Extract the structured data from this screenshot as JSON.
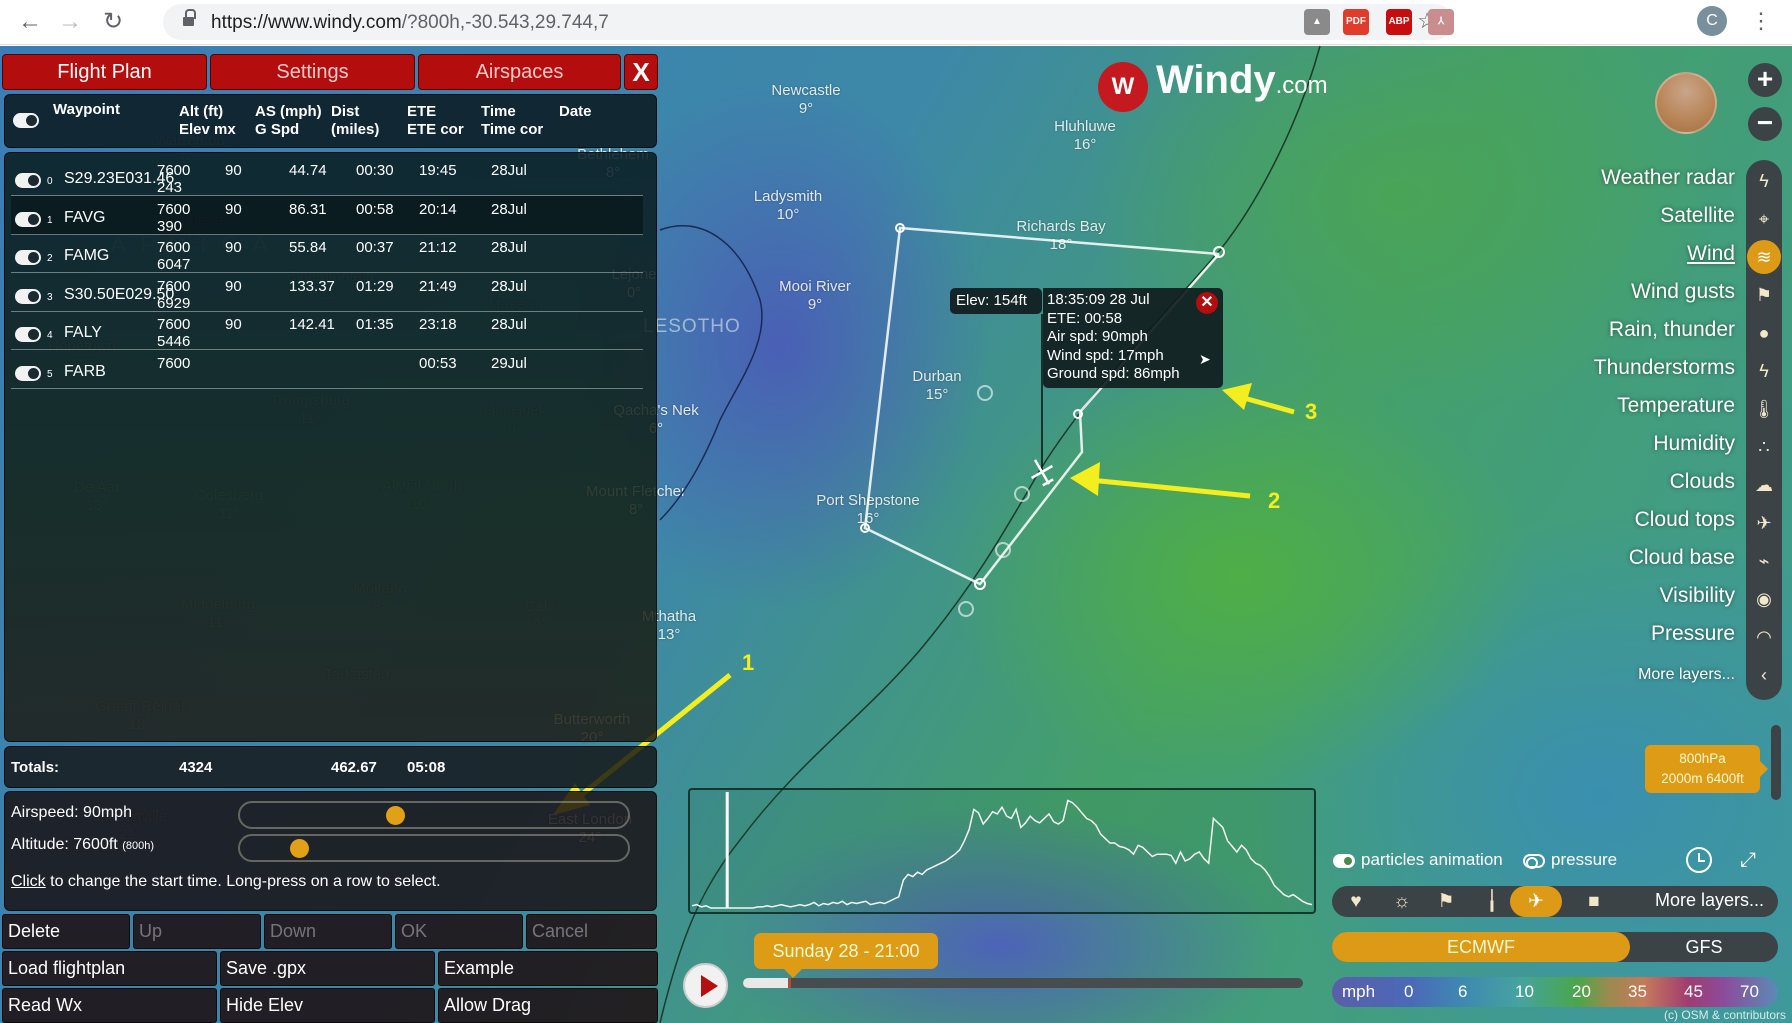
{
  "browser": {
    "url_prefix": "https://www.windy.com",
    "url_suffix": "/?800h,-30.543,29.744,7",
    "back_icon": "←",
    "forward_icon": "→",
    "reload_icon": "↻",
    "star_icon": "☆",
    "extensions": [
      {
        "name": "google-drive",
        "label": "▲",
        "color": "#8a8a8a"
      },
      {
        "name": "pdf-js",
        "label": "PDF",
        "color": "#e03c2c"
      },
      {
        "name": "adblock-plus",
        "label": "ABP",
        "color": "#c70d0d"
      },
      {
        "name": "acrobat",
        "label": "⅄",
        "color": "#c98d8d"
      }
    ],
    "profile_initial": "C",
    "menu_icon": "⋮"
  },
  "panel": {
    "tabs": [
      "Flight Plan",
      "Settings",
      "Airspaces"
    ],
    "active_tab": "Flight Plan",
    "close_label": "X",
    "headers": {
      "waypoint": "Waypoint",
      "alt": "Alt (ft)",
      "elev": "Elev mx",
      "as": "AS (mph)",
      "gspd": "G Spd",
      "dist": "Dist",
      "dist_unit": "(miles)",
      "ete": "ETE",
      "ete_cor": "ETE cor",
      "time": "Time",
      "time_cor": "Time cor",
      "date": "Date"
    },
    "rows": [
      {
        "idx": "0",
        "waypoint": "S29.23E031.46",
        "alt": "7600",
        "elev": "243",
        "as": "90",
        "dist": "44.74",
        "ete": "00:30",
        "time": "19:45",
        "date": "28Jul"
      },
      {
        "idx": "1",
        "waypoint": "FAVG",
        "alt": "7600",
        "elev": "390",
        "as": "90",
        "dist": "86.31",
        "ete": "00:58",
        "time": "20:14",
        "date": "28Jul"
      },
      {
        "idx": "2",
        "waypoint": "FAMG",
        "alt": "7600",
        "elev": "6047",
        "as": "90",
        "dist": "55.84",
        "ete": "00:37",
        "time": "21:12",
        "date": "28Jul"
      },
      {
        "idx": "3",
        "waypoint": "S30.50E029.50",
        "alt": "7600",
        "elev": "6929",
        "as": "90",
        "dist": "133.37",
        "ete": "01:29",
        "time": "21:49",
        "date": "28Jul"
      },
      {
        "idx": "4",
        "waypoint": "FALY",
        "alt": "7600",
        "elev": "5446",
        "as": "90",
        "dist": "142.41",
        "ete": "01:35",
        "time": "23:18",
        "date": "28Jul"
      },
      {
        "idx": "5",
        "waypoint": "FARB",
        "alt": "7600",
        "elev": "",
        "as": "",
        "dist": "",
        "ete": "",
        "time": "00:53",
        "date": "29Jul"
      }
    ],
    "totals": {
      "label": "Totals:",
      "elev": "4324",
      "dist": "462.67",
      "ete": "05:08"
    },
    "airspeed_label": "Airspeed: 90mph",
    "airspeed_fraction": 0.39,
    "altitude_label": "Altitude: 7600ft",
    "altitude_level": "(800h)",
    "altitude_fraction": 0.13,
    "hint_link": "Click",
    "hint_text": " to change the start time. Long-press on a row to select.",
    "buttons_row1": [
      {
        "label": "Delete",
        "enabled": true
      },
      {
        "label": "Up",
        "enabled": false
      },
      {
        "label": "Down",
        "enabled": false
      },
      {
        "label": "OK",
        "enabled": false
      },
      {
        "label": "Cancel",
        "enabled": false
      }
    ],
    "buttons_row2": [
      "Load flightplan",
      "Save .gpx",
      "Example"
    ],
    "buttons_row3": [
      "Read Wx",
      "Hide Elev",
      "Allow Drag"
    ]
  },
  "map": {
    "logo_text": "Windy",
    "logo_suffix": ".com",
    "country_labels": [
      "LESOTHO",
      "AFRICA"
    ],
    "places": [
      {
        "name": "Newcastle",
        "temp": "9°",
        "faded": false
      },
      {
        "name": "Bethlehem",
        "temp": "8°",
        "faded": false
      },
      {
        "name": "Hluhluwe",
        "temp": "16°",
        "faded": false
      },
      {
        "name": "Ladysmith",
        "temp": "10°",
        "faded": false
      },
      {
        "name": "Richards Bay",
        "temp": "18°",
        "faded": false
      },
      {
        "name": "Lejone",
        "temp": "0°",
        "faded": false
      },
      {
        "name": "Mooi River",
        "temp": "9°",
        "faded": false
      },
      {
        "name": "Durban",
        "temp": "15°",
        "faded": false
      },
      {
        "name": "Qacha's Nek",
        "temp": "6°",
        "faded": false
      },
      {
        "name": "Mount Fletcher",
        "temp": "8°",
        "faded": false
      },
      {
        "name": "Port Shepstone",
        "temp": "16°",
        "faded": false
      },
      {
        "name": "Mthatha",
        "temp": "13°",
        "faded": false
      },
      {
        "name": "Butterworth",
        "temp": "20°",
        "faded": false
      },
      {
        "name": "East London",
        "temp": "24°",
        "faded": false
      },
      {
        "name": "Warrenton",
        "temp": "10°",
        "faded": true
      },
      {
        "name": "Kimberley",
        "temp": "12°",
        "faded": true
      },
      {
        "name": "Bloemfontein",
        "temp": "13°",
        "faded": true
      },
      {
        "name": "Maseru",
        "temp": "",
        "faded": true
      },
      {
        "name": "Hopetown",
        "temp": "12°",
        "faded": true
      },
      {
        "name": "Trompsburg",
        "temp": "11°",
        "faded": true
      },
      {
        "name": "Old Hoek",
        "temp": "9°",
        "faded": true
      },
      {
        "name": "De Aar",
        "temp": "13°",
        "faded": true
      },
      {
        "name": "Colesberg",
        "temp": "11°",
        "faded": true
      },
      {
        "name": "Aliwal North",
        "temp": "10°",
        "faded": true
      },
      {
        "name": "Molteno",
        "temp": "8°",
        "faded": true
      },
      {
        "name": "Middelburg",
        "temp": "11°",
        "faded": true
      },
      {
        "name": "Cala",
        "temp": "9°",
        "faded": true
      },
      {
        "name": "Graaff-Reinet",
        "temp": "18°",
        "faded": true
      },
      {
        "name": "Tarkastad",
        "temp": "",
        "faded": true
      },
      {
        "name": "Jansenville",
        "temp": "21°",
        "faded": true
      },
      {
        "name": "Willowmore",
        "temp": "",
        "faded": true
      }
    ],
    "popup": {
      "elev": "Elev: 154ft",
      "lines": [
        "18:35:09   28 Jul",
        "ETE: 00:58",
        "Air spd: 90mph",
        "Wind spd: 17mph",
        "Ground spd: 86mph"
      ],
      "close_label": "✕"
    },
    "annotations": [
      "1",
      "2",
      "3"
    ]
  },
  "layers": {
    "zoom_in": "+",
    "zoom_out": "−",
    "items": [
      {
        "label": "Weather radar",
        "icon": "weather-radar-icon",
        "glyph": "ϟ"
      },
      {
        "label": "Satellite",
        "icon": "satellite-icon",
        "glyph": "⌖"
      },
      {
        "label": "Wind",
        "icon": "wind-icon",
        "glyph": "≋",
        "active": true
      },
      {
        "label": "Wind gusts",
        "icon": "windsock-icon",
        "glyph": "⚑"
      },
      {
        "label": "Rain, thunder",
        "icon": "raindrop-icon",
        "glyph": "●"
      },
      {
        "label": "Thunderstorms",
        "icon": "thunderstorm-icon",
        "glyph": "ϟ"
      },
      {
        "label": "Temperature",
        "icon": "thermometer-icon",
        "glyph": "🌡"
      },
      {
        "label": "Humidity",
        "icon": "humidity-icon",
        "glyph": "∴"
      },
      {
        "label": "Clouds",
        "icon": "clouds-icon",
        "glyph": "☁"
      },
      {
        "label": "Cloud tops",
        "icon": "airplane-icon",
        "glyph": "✈"
      },
      {
        "label": "Cloud base",
        "icon": "helicopter-icon",
        "glyph": "⌁"
      },
      {
        "label": "Visibility",
        "icon": "eye-icon",
        "glyph": "◉"
      },
      {
        "label": "Pressure",
        "icon": "gauge-icon",
        "glyph": "◠"
      },
      {
        "label": "More layers...",
        "icon": "chevron-left-icon",
        "glyph": "‹"
      }
    ],
    "level_line1": "800hPa",
    "level_line2": "2000m 6400ft"
  },
  "bottom": {
    "particles_label": "particles animation",
    "pressure_label": "pressure",
    "quickbar_icons": [
      {
        "name": "heart-icon",
        "glyph": "♥"
      },
      {
        "name": "sun-cloud-icon",
        "glyph": "☼"
      },
      {
        "name": "windsock-icon",
        "glyph": "⚑"
      },
      {
        "name": "thermometer-icon",
        "glyph": "╽"
      },
      {
        "name": "airplane-icon",
        "glyph": "✈",
        "active": true
      },
      {
        "name": "video-camera-icon",
        "glyph": "■"
      }
    ],
    "quickbar_more": "More layers...",
    "models": [
      "ECMWF",
      "GFS"
    ],
    "active_model": "ECMWF",
    "legend_unit": "mph",
    "legend_values": [
      "0",
      "6",
      "10",
      "20",
      "35",
      "45",
      "70"
    ],
    "time_label": "Sunday 28 - 21:00",
    "timeline_progress": 0.085,
    "attribution": "(c) OSM & contributors"
  },
  "elevation_profile": {
    "current_position_fraction": 0.06,
    "values": [
      2,
      3,
      1,
      2,
      0,
      0,
      0,
      0,
      0,
      0,
      0,
      0,
      0,
      0,
      1,
      1,
      2,
      1,
      2,
      3,
      2,
      1,
      2,
      3,
      2,
      3,
      5,
      2,
      4,
      3,
      5,
      4,
      6,
      3,
      5,
      4,
      5,
      6,
      3,
      4,
      5,
      4,
      6,
      8,
      10,
      25,
      30,
      28,
      32,
      30,
      34,
      36,
      38,
      40,
      42,
      45,
      48,
      52,
      60,
      70,
      88,
      85,
      75,
      80,
      86,
      84,
      90,
      82,
      80,
      88,
      72,
      76,
      82,
      78,
      76,
      80,
      84,
      77,
      75,
      78,
      96,
      94,
      90,
      85,
      80,
      78,
      74,
      66,
      62,
      58,
      58,
      55,
      54,
      52,
      48,
      56,
      54,
      50,
      46,
      48,
      48,
      48,
      47,
      40,
      50,
      42,
      44,
      48,
      50,
      44,
      40,
      80,
      76,
      72,
      60,
      55,
      50,
      56,
      52,
      44,
      40,
      38,
      34,
      28,
      20,
      16,
      12,
      10,
      12,
      9,
      6,
      4,
      3
    ]
  }
}
